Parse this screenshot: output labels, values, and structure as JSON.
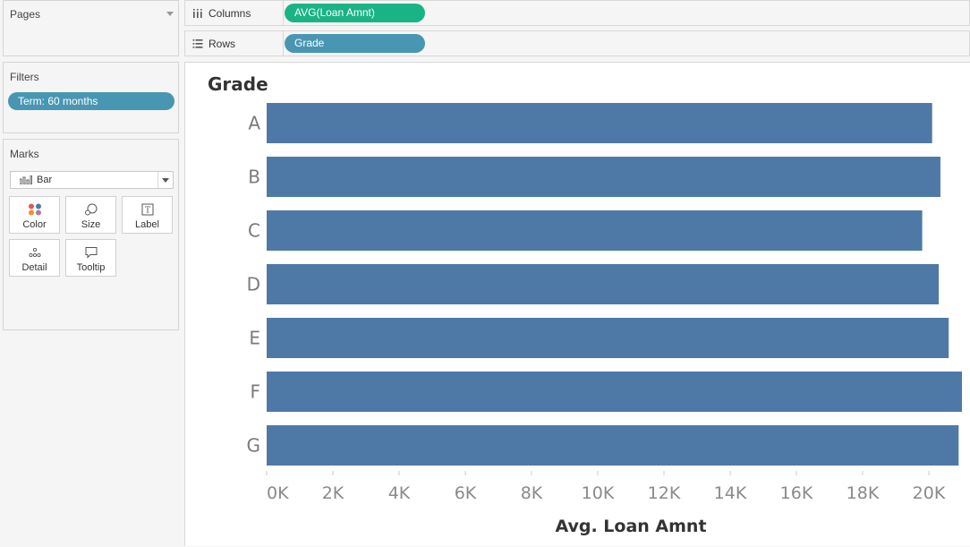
{
  "cards": {
    "pages": {
      "title": "Pages"
    },
    "filters": {
      "title": "Filters",
      "items": [
        {
          "label": "Term: 60 months"
        }
      ]
    },
    "marks": {
      "title": "Marks",
      "mark_type": "Bar",
      "buttons": [
        {
          "label": "Color",
          "icon": "color-dots-icon"
        },
        {
          "label": "Size",
          "icon": "size-circles-icon"
        },
        {
          "label": "Label",
          "icon": "text-label-icon"
        },
        {
          "label": "Detail",
          "icon": "detail-dots-icon"
        },
        {
          "label": "Tooltip",
          "icon": "speech-bubble-icon"
        }
      ]
    }
  },
  "shelves": {
    "columns": {
      "label": "Columns",
      "pill": "AVG(Loan Amnt)",
      "pill_color": "#1ab386"
    },
    "rows": {
      "label": "Rows",
      "pill": "Grade",
      "pill_color": "#4996b2"
    }
  },
  "chart_data": {
    "type": "bar",
    "orientation": "horizontal",
    "row_header": "Grade",
    "categories": [
      "A",
      "B",
      "C",
      "D",
      "E",
      "F",
      "G"
    ],
    "values": [
      20100,
      20350,
      19800,
      20300,
      20600,
      21000,
      20900
    ],
    "xlabel": "Avg. Loan Amnt",
    "xlim": [
      0,
      21000
    ],
    "x_ticks": [
      "0K",
      "2K",
      "4K",
      "6K",
      "8K",
      "10K",
      "12K",
      "14K",
      "16K",
      "18K",
      "20K"
    ],
    "x_tick_values": [
      0,
      2000,
      4000,
      6000,
      8000,
      10000,
      12000,
      14000,
      16000,
      18000,
      20000
    ],
    "bar_color": "#4e79a7",
    "grid": false
  }
}
